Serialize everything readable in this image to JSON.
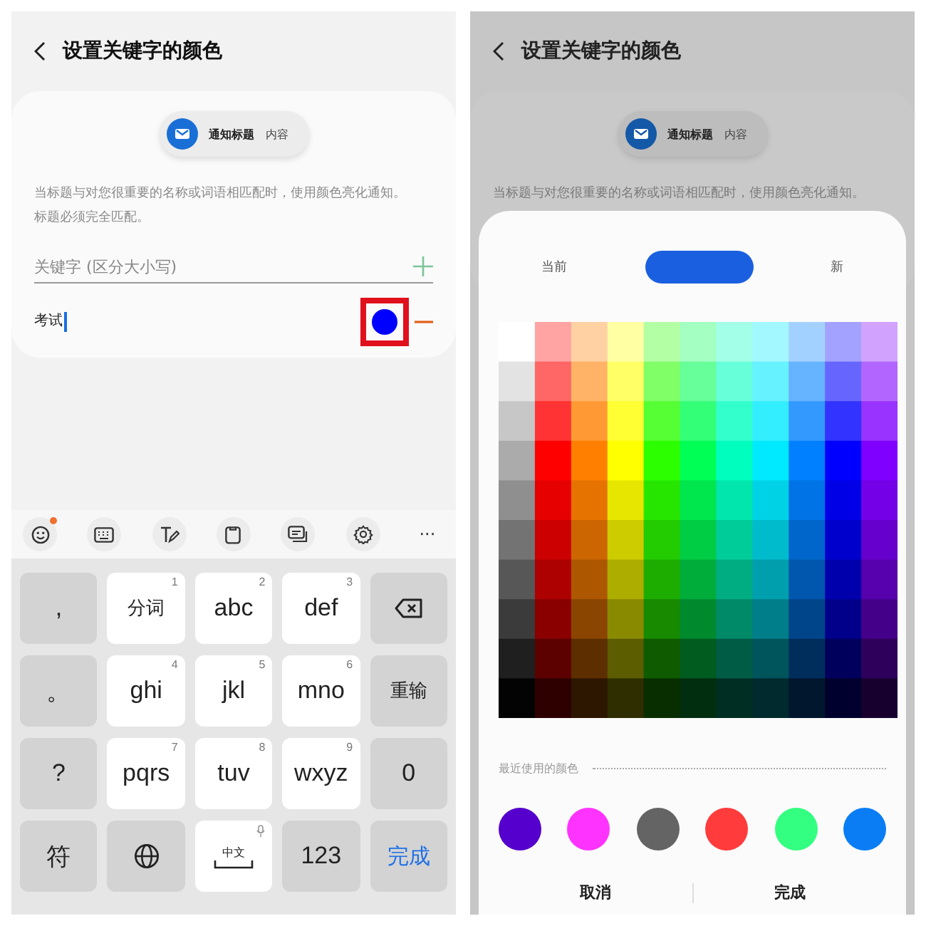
{
  "left_screen": {
    "header": {
      "title": "设置关键字的颜色"
    },
    "preview": {
      "title": "通知标题",
      "content": "内容"
    },
    "description": [
      "当标题与对您很重要的名称或词语相匹配时，使用颜色亮化通知。",
      "标题必须完全匹配。"
    ],
    "keyword_field": {
      "placeholder": "关键字 (区分大小写)"
    },
    "keywords": [
      {
        "text": "考试",
        "color": "#0000ff",
        "focused": true,
        "annotated": true
      }
    ],
    "keyboard": {
      "toolbar": [
        {
          "kind": "emoji",
          "badge": true
        },
        {
          "kind": "keyboard"
        },
        {
          "kind": "handwriting"
        },
        {
          "kind": "clipboard"
        },
        {
          "kind": "cards"
        },
        {
          "kind": "settings"
        },
        {
          "kind": "more",
          "label": "···"
        }
      ],
      "keys": [
        {
          "kind": "function",
          "label": ","
        },
        {
          "kind": "letter",
          "label": "分词",
          "hint": "1"
        },
        {
          "kind": "letter",
          "label": "abc",
          "hint": "2"
        },
        {
          "kind": "letter",
          "label": "def",
          "hint": "3"
        },
        {
          "kind": "backspace"
        },
        {
          "kind": "function",
          "label": "。"
        },
        {
          "kind": "letter",
          "label": "ghi",
          "hint": "4"
        },
        {
          "kind": "letter",
          "label": "jkl",
          "hint": "5"
        },
        {
          "kind": "letter",
          "label": "mno",
          "hint": "6"
        },
        {
          "kind": "function",
          "label": "重输"
        },
        {
          "kind": "function",
          "label": "?"
        },
        {
          "kind": "letter",
          "label": "pqrs",
          "hint": "7"
        },
        {
          "kind": "letter",
          "label": "tuv",
          "hint": "8"
        },
        {
          "kind": "letter",
          "label": "wxyz",
          "hint": "9"
        },
        {
          "kind": "function",
          "label": "0"
        },
        {
          "kind": "function",
          "label": "符"
        },
        {
          "kind": "globe"
        },
        {
          "kind": "space",
          "label": "中文"
        },
        {
          "kind": "function",
          "label": "123"
        },
        {
          "kind": "done",
          "label": "完成"
        }
      ]
    }
  },
  "right_screen": {
    "header": {
      "title": "设置关键字的颜色"
    },
    "preview": {
      "title": "通知标题",
      "content": "内容"
    },
    "description": [
      "当标题与对您很重要的名称或词语相匹配时，使用颜色亮化通知。"
    ],
    "color_sheet": {
      "current_label": "当前",
      "new_label": "新",
      "recent_label": "最近使用的颜色",
      "recent_colors": [
        {
          "color": "#5500cc"
        },
        {
          "color": "#ff33ff"
        },
        {
          "color": "#646464"
        },
        {
          "color": "#ff3b3b"
        },
        {
          "color": "#33ff80"
        },
        {
          "color": "#0a7df5"
        }
      ],
      "buttons": [
        {
          "label": "取消"
        },
        {
          "label": "完成"
        }
      ]
    }
  }
}
